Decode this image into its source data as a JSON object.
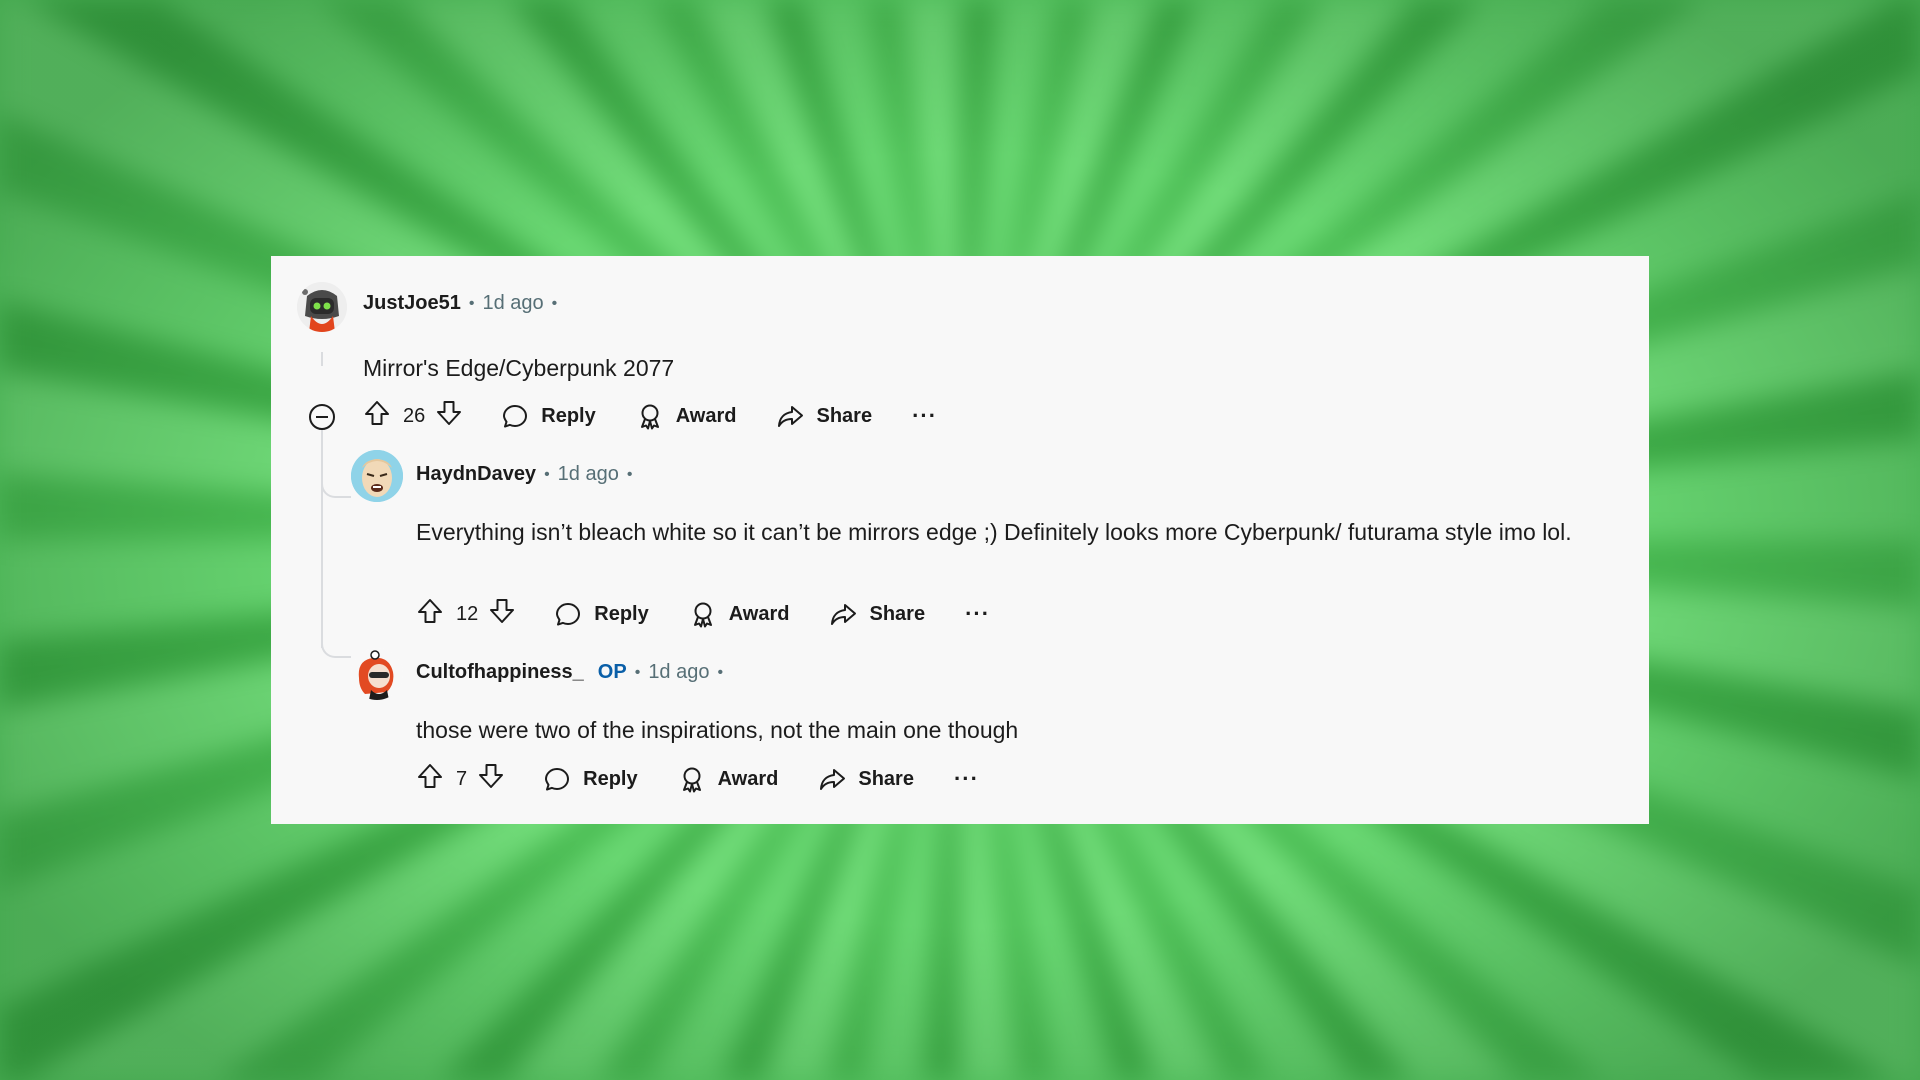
{
  "comments": [
    {
      "username": "JustJoe51",
      "time": "1d ago",
      "body": "Mirror's Edge/Cyberpunk 2077",
      "votes": "26",
      "reply_label": "Reply",
      "award_label": "Award",
      "share_label": "Share",
      "more_label": "···"
    },
    {
      "username": "HaydnDavey",
      "time": "1d ago",
      "body": "Everything isn’t bleach white so it can’t be mirrors edge ;) Definitely looks more Cyberpunk/ futurama style imo lol.",
      "votes": "12",
      "reply_label": "Reply",
      "award_label": "Award",
      "share_label": "Share",
      "more_label": "···"
    },
    {
      "username": "Cultofhappiness_",
      "op_badge": "OP",
      "time": "1d ago",
      "body": "those were two of the inspirations, not the main one though",
      "votes": "7",
      "reply_label": "Reply",
      "award_label": "Award",
      "share_label": "Share",
      "more_label": "···"
    }
  ],
  "separator": "•",
  "colors": {
    "background_green": "#5fd46a",
    "card": "#f8f8f8",
    "op_blue": "#0a5fa8",
    "meta_gray": "#576f76",
    "thread_line": "#dadcdf"
  }
}
